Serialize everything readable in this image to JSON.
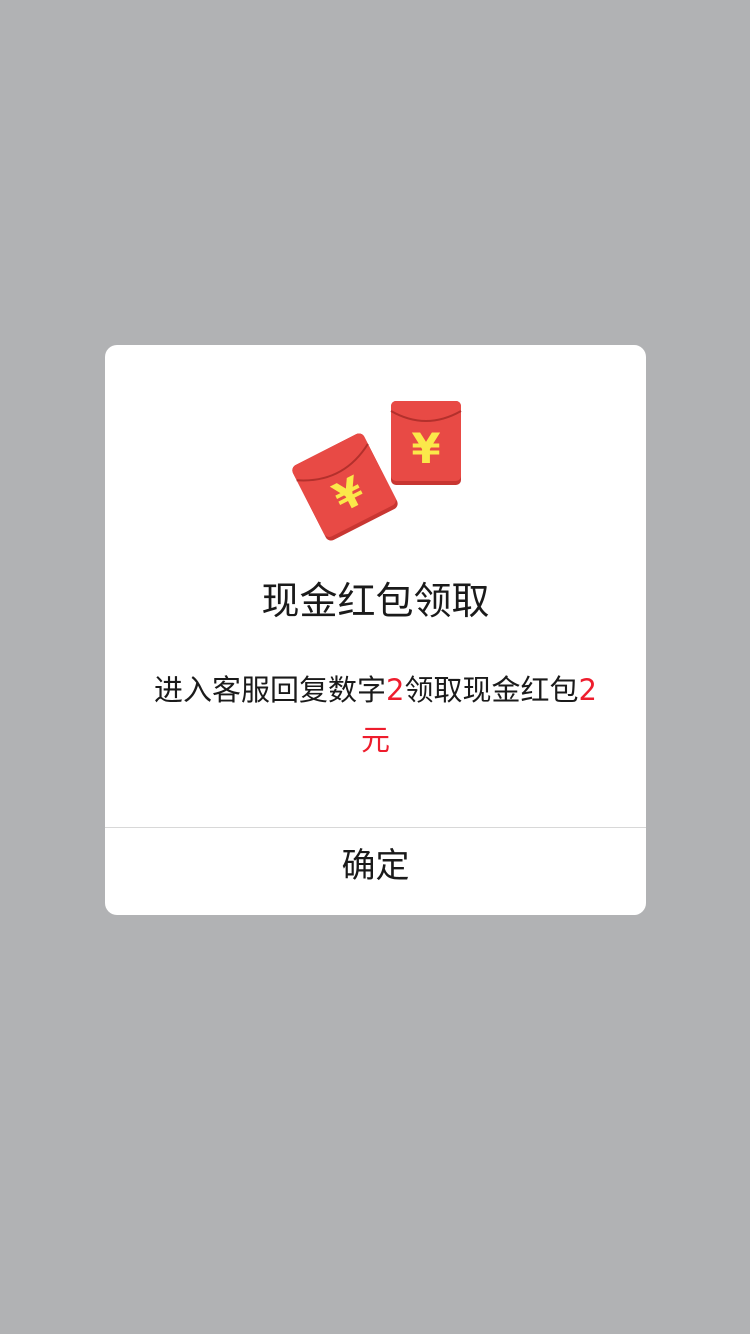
{
  "colors": {
    "overlay": "#b1b2b4",
    "divider": "#d8d8d8",
    "highlight": "#ee1d2d",
    "envelope_red": "#e84a45",
    "envelope_dark": "#c83632",
    "yuan_yellow": "#fbe84a"
  },
  "dialog": {
    "illustration_icon": "red-envelope-pair",
    "title": "现金红包领取",
    "message": {
      "part1": "进入客服回复数字",
      "number": "2",
      "part2": "领取现金红包",
      "amount": "2元"
    },
    "confirm_label": "确定"
  }
}
